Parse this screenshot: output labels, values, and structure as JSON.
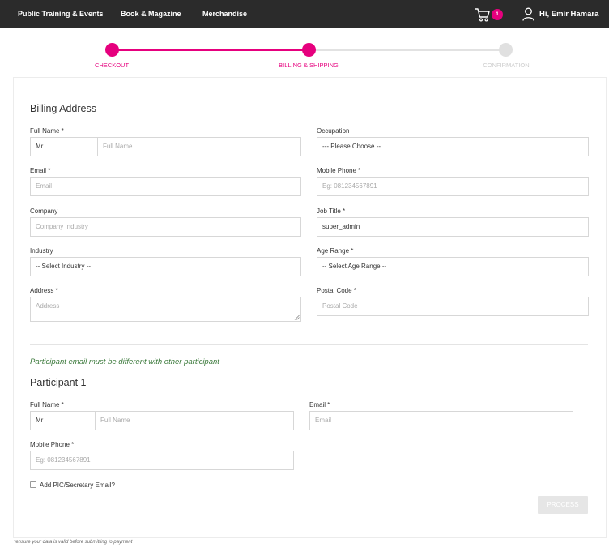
{
  "nav": {
    "links": [
      "Public Training & Events",
      "Book & Magazine",
      "Merchandise"
    ],
    "cart_count": "1",
    "user_greeting": "Hi, Emir Hamara"
  },
  "stepper": {
    "steps": [
      "CHECKOUT",
      "BILLING & SHIPPING",
      "CONFIRMATION"
    ],
    "active_color": "#e6007e",
    "inactive_color": "#e0e0e0"
  },
  "billing": {
    "title": "Billing Address",
    "full_name_label": "Full Name *",
    "title_value": "Mr",
    "full_name_placeholder": "Full Name",
    "email_label": "Email *",
    "email_placeholder": "Email",
    "company_label": "Company",
    "company_placeholder": "Company Industry",
    "industry_label": "Industry",
    "industry_value": "-- Select Industry --",
    "address_label": "Address *",
    "address_placeholder": "Address",
    "occupation_label": "Occupation",
    "occupation_value": "--- Please Choose --",
    "mobile_label": "Mobile Phone *",
    "mobile_placeholder": "Eg: 081234567891",
    "job_title_label": "Job Title *",
    "job_title_value": "super_admin",
    "age_range_label": "Age Range *",
    "age_range_value": "-- Select Age Range --",
    "postal_label": "Postal Code *",
    "postal_placeholder": "Postal Code"
  },
  "note": "Participant email must be different with other participant",
  "participant": {
    "title": "Participant 1",
    "full_name_label": "Full Name *",
    "title_value": "Mr",
    "full_name_placeholder": "Full Name",
    "email_label": "Email *",
    "email_placeholder": "Email",
    "mobile_label": "Mobile Phone *",
    "mobile_placeholder": "Eg: 081234567891",
    "pic_checkbox_label": "Add PIC/Secretary Email?"
  },
  "process_button": "PROCESS",
  "footer_note": "*ensure your data is valid before submitting to payment"
}
